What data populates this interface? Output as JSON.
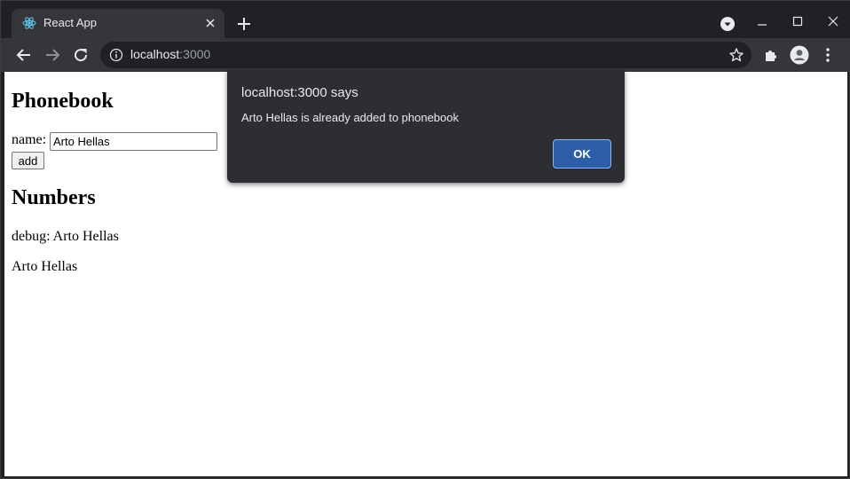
{
  "browser": {
    "tab": {
      "title": "React App"
    },
    "omnibox": {
      "host": "localhost",
      "port": ":3000"
    },
    "colors": {
      "frame": "#202124",
      "toolbar": "#35363a",
      "accent": "#8ab4f8"
    }
  },
  "page": {
    "heading_phonebook": "Phonebook",
    "form": {
      "name_label": "name:",
      "name_value": "Arto Hellas",
      "add_label": "add"
    },
    "heading_numbers": "Numbers",
    "debug_text": "debug: Arto Hellas",
    "persons": [
      "Arto Hellas"
    ]
  },
  "dialog": {
    "title": "localhost:3000 says",
    "message": "Arto Hellas is already added to phonebook",
    "ok_label": "OK"
  },
  "icons": [
    "react-favicon-icon",
    "close-icon",
    "plus-icon",
    "tab-search-icon",
    "minimize-icon",
    "maximize-icon",
    "window-close-icon",
    "back-arrow-icon",
    "forward-arrow-icon",
    "reload-icon",
    "info-icon",
    "star-icon",
    "extensions-puzzle-icon",
    "profile-icon",
    "more-menu-icon"
  ]
}
